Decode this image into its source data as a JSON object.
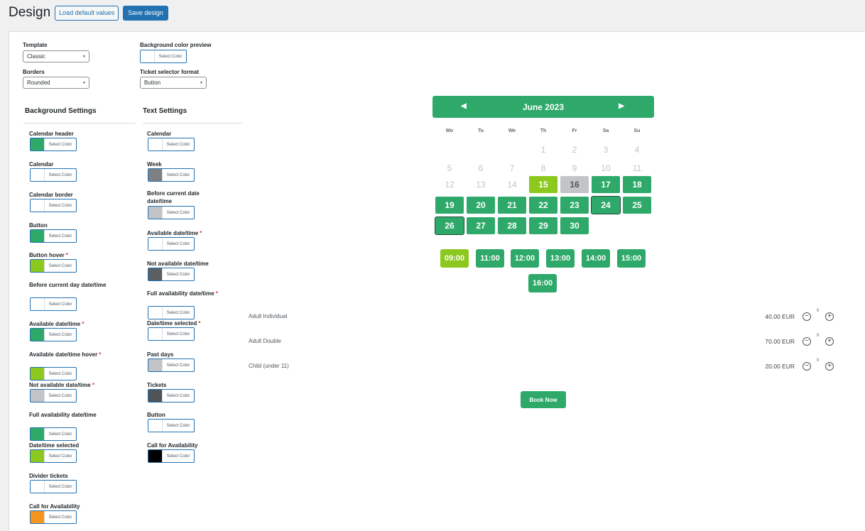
{
  "header": {
    "title": "Design",
    "load_defaults_label": "Load default values",
    "save_label": "Save design"
  },
  "settings": {
    "template_label": "Template",
    "template_value": "Classic",
    "borders_label": "Borders",
    "borders_value": "Rounded",
    "bg_preview_label": "Background color preview",
    "ticket_format_label": "Ticket selector format",
    "ticket_format_value": "Button"
  },
  "select_color_text": "Select Color",
  "background_settings": {
    "title": "Background Settings",
    "items": [
      {
        "label": "Calendar header",
        "required": false,
        "color": "#2ea96a"
      },
      {
        "label": "Calendar",
        "required": false,
        "color": "#ffffff"
      },
      {
        "label": "Calendar border",
        "required": false,
        "color": "#ffffff"
      },
      {
        "label": "Button",
        "required": false,
        "color": "#2ea96a"
      },
      {
        "label": "Button hover",
        "required": true,
        "color": "#8cc81d"
      },
      {
        "label": "Before current day date/time",
        "required": false,
        "color": "#ffffff"
      },
      {
        "label": "Available date/time",
        "required": true,
        "color": "#2ea96a"
      },
      {
        "label": "Available date/time hover",
        "required": true,
        "color": "#8cc81d"
      },
      {
        "label": "Not available date/time",
        "required": true,
        "color": "#c3c4c7"
      },
      {
        "label": "Full availability date/time",
        "required": false,
        "color": "#2ea96a"
      },
      {
        "label": "Date/time selected",
        "required": false,
        "color": "#8cc81d"
      },
      {
        "label": "Divider tickets",
        "required": false,
        "color": "#ffffff"
      },
      {
        "label": "Call for Availability",
        "required": false,
        "color": "#f7941d"
      }
    ]
  },
  "text_settings": {
    "title": "Text Settings",
    "items": [
      {
        "label": "Calendar",
        "required": false,
        "color": "#ffffff"
      },
      {
        "label": "Week",
        "required": false,
        "color": "#7e8083"
      },
      {
        "label": "Before current date date/time",
        "required": false,
        "color": "#c3c4c7"
      },
      {
        "label": "Available date/time",
        "required": true,
        "color": "#ffffff"
      },
      {
        "label": "Not available date/time",
        "required": false,
        "color": "#5b5e62"
      },
      {
        "label": "Full availability date/time",
        "required": true,
        "color": "#ffffff"
      },
      {
        "label": "Date/time selected",
        "required": true,
        "color": "#ffffff"
      },
      {
        "label": "Past days",
        "required": false,
        "color": "#c3c4c7"
      },
      {
        "label": "Tickets",
        "required": false,
        "color": "#4f5458"
      },
      {
        "label": "Button",
        "required": false,
        "color": "#ffffff"
      },
      {
        "label": "Call for Availability",
        "required": false,
        "color": "#000000"
      }
    ]
  },
  "calendar": {
    "month_label": "June 2023",
    "weekdays": [
      "Mo",
      "Tu",
      "We",
      "Th",
      "Fr",
      "Sa",
      "Su"
    ],
    "days": [
      {
        "n": "1",
        "state": "past",
        "col": 3,
        "row": 0
      },
      {
        "n": "2",
        "state": "past",
        "col": 4,
        "row": 0
      },
      {
        "n": "3",
        "state": "past",
        "col": 5,
        "row": 0
      },
      {
        "n": "4",
        "state": "past",
        "col": 6,
        "row": 0
      },
      {
        "n": "5",
        "state": "past",
        "col": 0,
        "row": 1
      },
      {
        "n": "6",
        "state": "past",
        "col": 1,
        "row": 1
      },
      {
        "n": "7",
        "state": "past",
        "col": 2,
        "row": 1
      },
      {
        "n": "8",
        "state": "past",
        "col": 3,
        "row": 1
      },
      {
        "n": "9",
        "state": "past",
        "col": 4,
        "row": 1
      },
      {
        "n": "10",
        "state": "past",
        "col": 5,
        "row": 1
      },
      {
        "n": "11",
        "state": "past",
        "col": 6,
        "row": 1
      },
      {
        "n": "12",
        "state": "past",
        "col": 0,
        "row": 2
      },
      {
        "n": "13",
        "state": "past",
        "col": 1,
        "row": 2
      },
      {
        "n": "14",
        "state": "past",
        "col": 2,
        "row": 2
      },
      {
        "n": "15",
        "state": "sel",
        "col": 3,
        "row": 2
      },
      {
        "n": "16",
        "state": "na",
        "col": 4,
        "row": 2
      },
      {
        "n": "17",
        "state": "avail",
        "col": 5,
        "row": 2
      },
      {
        "n": "18",
        "state": "avail",
        "col": 6,
        "row": 2
      },
      {
        "n": "19",
        "state": "avail",
        "col": 0,
        "row": 3
      },
      {
        "n": "20",
        "state": "avail",
        "col": 1,
        "row": 3
      },
      {
        "n": "21",
        "state": "avail",
        "col": 2,
        "row": 3
      },
      {
        "n": "22",
        "state": "avail",
        "col": 3,
        "row": 3
      },
      {
        "n": "23",
        "state": "avail",
        "col": 4,
        "row": 3
      },
      {
        "n": "24",
        "state": "avail bordered",
        "col": 5,
        "row": 3
      },
      {
        "n": "25",
        "state": "avail",
        "col": 6,
        "row": 3
      },
      {
        "n": "26",
        "state": "avail bordered",
        "col": 0,
        "row": 4
      },
      {
        "n": "27",
        "state": "avail",
        "col": 1,
        "row": 4
      },
      {
        "n": "28",
        "state": "avail",
        "col": 2,
        "row": 4
      },
      {
        "n": "29",
        "state": "avail",
        "col": 3,
        "row": 4
      },
      {
        "n": "30",
        "state": "avail",
        "col": 4,
        "row": 4
      }
    ],
    "times": [
      {
        "label": "09:00",
        "selected": true
      },
      {
        "label": "11:00",
        "selected": false
      },
      {
        "label": "12:00",
        "selected": false
      },
      {
        "label": "13:00",
        "selected": false
      },
      {
        "label": "14:00",
        "selected": false
      },
      {
        "label": "15:00",
        "selected": false
      },
      {
        "label": "16:00",
        "selected": false
      }
    ]
  },
  "tickets": [
    {
      "name": "Adult Individual",
      "price": "40.00 EUR",
      "qty": "0"
    },
    {
      "name": "Adult Double",
      "price": "70.00 EUR",
      "qty": "0"
    },
    {
      "name": "Child (under 11)",
      "price": "20.00 EUR",
      "qty": "0"
    }
  ],
  "book_label": "Book Now"
}
